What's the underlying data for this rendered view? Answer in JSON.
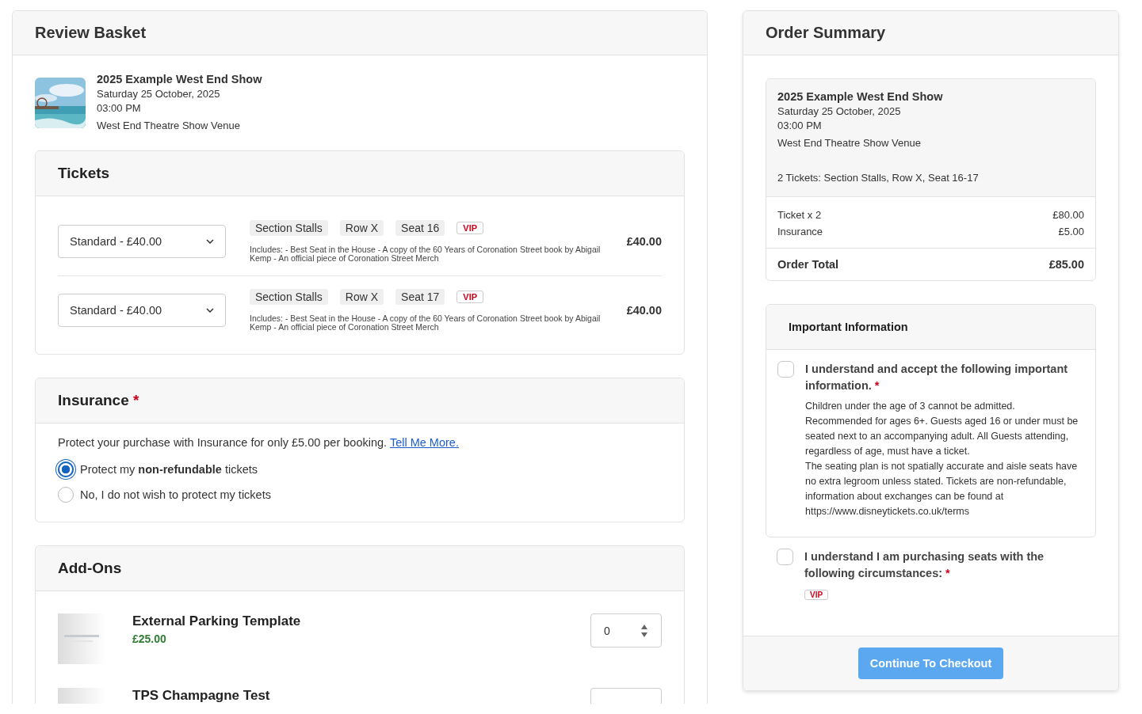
{
  "basket": {
    "title": "Review Basket",
    "event": {
      "name": "2025 Example West End Show",
      "date": "Saturday 25 October, 2025",
      "time": "03:00 PM",
      "venue": "West End Theatre Show Venue"
    }
  },
  "tickets": {
    "title": "Tickets",
    "items": [
      {
        "price_option": "Standard - £40.00",
        "tags": [
          "Section Stalls",
          "Row X",
          "Seat 16"
        ],
        "badge": "VIP",
        "includes": "Includes: - Best Seat in the House - A copy of the 60 Years of Coronation Street book by Abigail Kemp - An official piece of Coronation Street Merch",
        "price": "£40.00"
      },
      {
        "price_option": "Standard - £40.00",
        "tags": [
          "Section Stalls",
          "Row X",
          "Seat 17"
        ],
        "badge": "VIP",
        "includes": "Includes: - Best Seat in the House - A copy of the 60 Years of Coronation Street book by Abigail Kemp - An official piece of Coronation Street Merch",
        "price": "£40.00"
      }
    ]
  },
  "insurance": {
    "title": "Insurance",
    "required_mark": "*",
    "text": "Protect your purchase with Insurance for only £5.00 per booking.",
    "link": "Tell Me More.",
    "options": [
      {
        "label": "Protect my **non-refundable** tickets",
        "selected": true
      },
      {
        "label": "No, I do not wish to protect my tickets",
        "selected": false
      }
    ]
  },
  "addons": {
    "title": "Add-Ons",
    "items": [
      {
        "name": "External Parking Template",
        "price": "£25.00",
        "quantity": "0"
      },
      {
        "name": "TPS Champagne Test"
      }
    ]
  },
  "summary": {
    "title": "Order Summary",
    "event": {
      "name": "2025 Example West End Show",
      "date": "Saturday 25 October, 2025",
      "time": "03:00 PM",
      "venue": "West End Theatre Show Venue",
      "tickets_line": "2 Tickets: Section Stalls, Row X, Seat 16-17"
    },
    "lines": [
      {
        "label": "Ticket x 2",
        "amount": "£80.00"
      },
      {
        "label": "Insurance",
        "amount": "£5.00"
      }
    ],
    "total": {
      "label": "Order Total",
      "amount": "£85.00"
    },
    "important": {
      "title": "Important Information",
      "items": [
        {
          "checked": false,
          "label": "I understand and accept the following important information.",
          "required_mark": "*",
          "details": [
            "Children under the age of 3 cannot be admitted. Recommended for ages 6+. Guests aged 16 or under must be seated next to an accompanying adult. All Guests attending, regardless of age, must have a ticket.",
            "The seating plan is not spatially accurate and aisle seats have no extra legroom unless stated. Tickets are non-refundable, information about exchanges can be found at https://www.disneytickets.co.uk/terms"
          ]
        }
      ]
    },
    "circumstances": {
      "checked": false,
      "label": "I understand I am purchasing seats with the following circumstances:",
      "required_mark": "*",
      "badge": "VIP"
    },
    "button": "Continue To Checkout"
  }
}
